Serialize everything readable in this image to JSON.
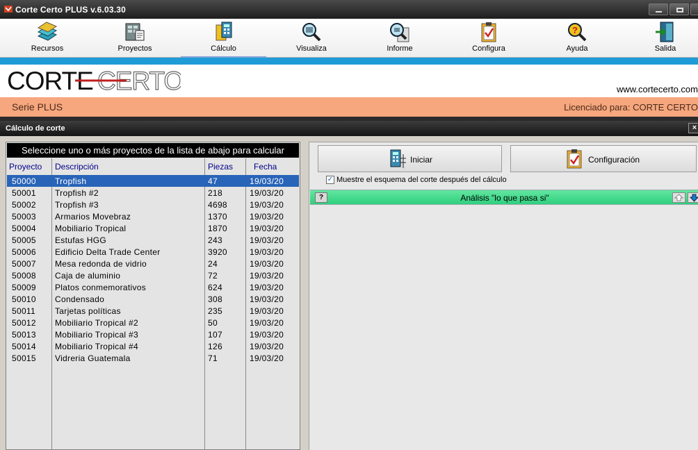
{
  "window": {
    "title": "Corte Certo  PLUS  v.6.03.30"
  },
  "toolbar": {
    "items": [
      {
        "label": "Recursos",
        "icon": "resources-icon"
      },
      {
        "label": "Proyectos",
        "icon": "projects-icon"
      },
      {
        "label": "Cálculo",
        "icon": "calculation-icon",
        "active": true
      },
      {
        "label": "Visualiza",
        "icon": "magnifier-icon"
      },
      {
        "label": "Informe",
        "icon": "report-icon"
      },
      {
        "label": "Configura",
        "icon": "clipboard-check-icon"
      },
      {
        "label": "Ayuda",
        "icon": "help-icon"
      },
      {
        "label": "Salida",
        "icon": "exit-door-icon"
      }
    ]
  },
  "banner": {
    "logo_text": "CORTE CERTO",
    "url": "www.cortecerto.com",
    "serie": "Serie PLUS",
    "licensed": "Licenciado para: CORTE CERTO"
  },
  "panel": {
    "title": "Cálculo de corte",
    "close": "×"
  },
  "list": {
    "header": "Seleccione uno o más proyectos de la lista de abajo para calcular",
    "columns": [
      "Proyecto",
      "Descripción",
      "Piezas",
      "Fecha"
    ],
    "rows": [
      {
        "id": "50000",
        "desc": "Tropfish",
        "pieces": "47",
        "date": "19/03/20",
        "selected": true
      },
      {
        "id": "50001",
        "desc": "Tropfish #2",
        "pieces": "218",
        "date": "19/03/20"
      },
      {
        "id": "50002",
        "desc": "Tropfish #3",
        "pieces": "4698",
        "date": "19/03/20"
      },
      {
        "id": "50003",
        "desc": "Armarios Movebraz",
        "pieces": "1370",
        "date": "19/03/20"
      },
      {
        "id": "50004",
        "desc": "Mobiliario Tropical",
        "pieces": "1870",
        "date": "19/03/20"
      },
      {
        "id": "50005",
        "desc": "Estufas HGG",
        "pieces": "243",
        "date": "19/03/20"
      },
      {
        "id": "50006",
        "desc": "Edificio Delta Trade Center",
        "pieces": "3920",
        "date": "19/03/20"
      },
      {
        "id": "50007",
        "desc": "Mesa redonda de vidrio",
        "pieces": "24",
        "date": "19/03/20"
      },
      {
        "id": "50008",
        "desc": "Caja de aluminio",
        "pieces": "72",
        "date": "19/03/20"
      },
      {
        "id": "50009",
        "desc": "Platos conmemorativos",
        "pieces": "624",
        "date": "19/03/20"
      },
      {
        "id": "50010",
        "desc": "Condensado",
        "pieces": "308",
        "date": "19/03/20"
      },
      {
        "id": "50011",
        "desc": "Tarjetas políticas",
        "pieces": "235",
        "date": "19/03/20"
      },
      {
        "id": "50012",
        "desc": "Mobiliario Tropical #2",
        "pieces": "50",
        "date": "19/03/20"
      },
      {
        "id": "50013",
        "desc": "Mobiliario Tropical #3",
        "pieces": "107",
        "date": "19/03/20"
      },
      {
        "id": "50014",
        "desc": "Mobiliario Tropical #4",
        "pieces": "126",
        "date": "19/03/20"
      },
      {
        "id": "50015",
        "desc": "Vidreria Guatemala",
        "pieces": "71",
        "date": "19/03/20"
      }
    ]
  },
  "actions": {
    "start_label": "Iniciar",
    "config_label": "Configuración",
    "show_scheme_label": "Muestre el esquema del corte después del cálculo",
    "show_scheme_checked": true
  },
  "whatif": {
    "help": "?",
    "label": "Análisis \"lo que pasa si\""
  },
  "colors": {
    "title_bar": "#2a2a2a",
    "accent_blue": "#1f9bd7",
    "orange_band": "#f6a77e",
    "selection": "#2864b8",
    "whatif_green": "#3cd88a"
  }
}
